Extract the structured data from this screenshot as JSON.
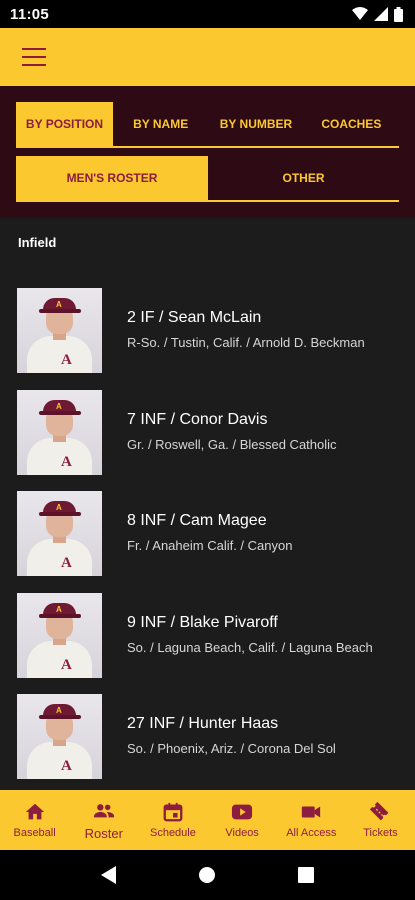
{
  "status": {
    "time": "11:05"
  },
  "tabs_primary": [
    "BY POSITION",
    "BY NAME",
    "BY NUMBER",
    "COACHES"
  ],
  "tabs_secondary": [
    "MEN'S ROSTER",
    "OTHER"
  ],
  "section": "Infield",
  "players": [
    {
      "name": "2 IF / Sean McLain",
      "meta": "R-So.  /  Tustin, Calif.  /  Arnold D. Beckman"
    },
    {
      "name": "7 INF / Conor Davis",
      "meta": "Gr.  /  Roswell, Ga.  /  Blessed Catholic"
    },
    {
      "name": "8 INF / Cam Magee",
      "meta": "Fr.  /  Anaheim Calif.  /  Canyon"
    },
    {
      "name": "9 INF / Blake Pivaroff",
      "meta": "So.  /  Laguna Beach, Calif.  /  Laguna Beach"
    },
    {
      "name": "27 INF / Hunter Haas",
      "meta": "So.  /  Phoenix, Ariz.  /  Corona Del Sol"
    }
  ],
  "photo_mark": {
    "cap_logo": "A",
    "chest_logo": "A"
  },
  "bottom_nav": [
    {
      "label": "Baseball",
      "icon": "home-icon"
    },
    {
      "label": "Roster",
      "icon": "people-icon"
    },
    {
      "label": "Schedule",
      "icon": "calendar-icon"
    },
    {
      "label": "Videos",
      "icon": "play-icon"
    },
    {
      "label": "All Access",
      "icon": "video-camera-icon"
    },
    {
      "label": "Tickets",
      "icon": "ticket-icon"
    }
  ],
  "colors": {
    "gold": "#fcc82f",
    "maroon": "#8c1d40",
    "dark_maroon": "#2d0a14",
    "background": "#1c1c1c"
  }
}
